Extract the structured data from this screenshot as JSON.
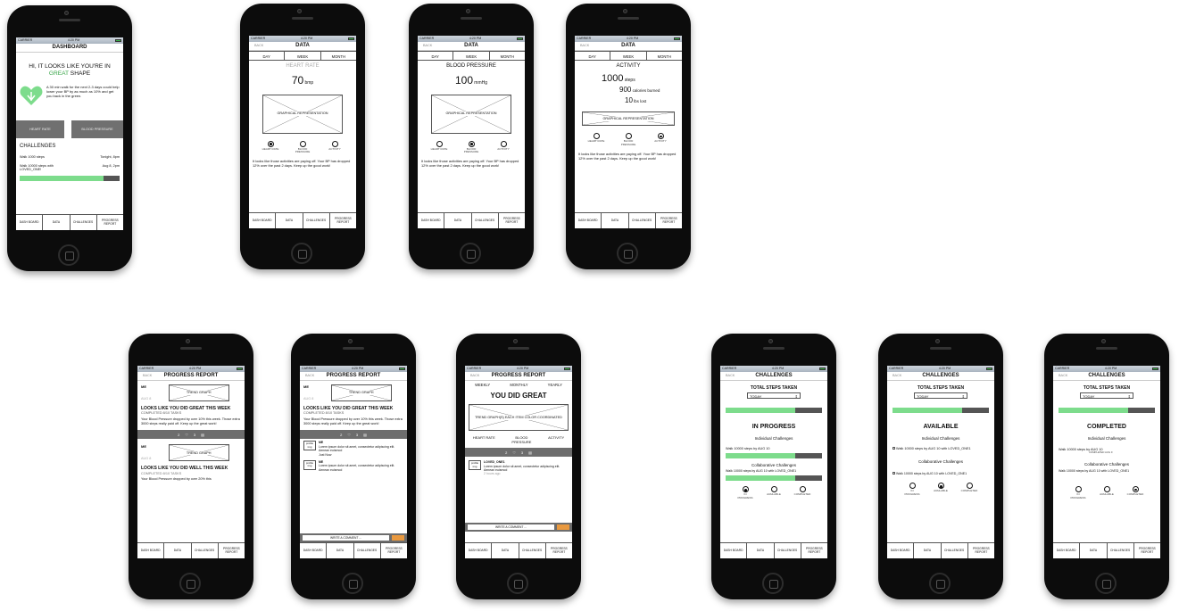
{
  "status": {
    "carrier": "CARRIER",
    "network": "5G",
    "time": "4:20 PM"
  },
  "tabs": {
    "dash": "DASH BOARD",
    "data": "DATA",
    "challenges": "CHALLENGES",
    "progress": "PROGRESS REPORT"
  },
  "back": "BACK",
  "dashboard": {
    "title": "DASHBOARD",
    "headline_a": "HI, IT LOOKS LIKE YOU'RE IN",
    "headline_great": "GREAT",
    "headline_b": "SHAPE",
    "tip": "A 30 min walk for the next 2-3 days could help lower your BP by as much as 10% and get you back in the green.",
    "btn_heart": "HEART RATE",
    "btn_bp": "BLOOD PRESSURE",
    "challenges_title": "CHALLENGES",
    "ch1": "Walk 1000 steps",
    "ch1_time": "Tonight, 8pm",
    "ch2": "Walk 10000 steps with LOVED_ONE!",
    "ch2_time": "Aug 8, 2pm",
    "progress": 0.78
  },
  "data": {
    "title": "DATA",
    "seg": [
      "DAY",
      "WEEK",
      "MONTH"
    ],
    "graphic": "GRAPHICAL REPRESENTATION",
    "radio_labels": [
      "HEART RATE",
      "BLOOD PRESSURE",
      "ACTIVITY"
    ],
    "note": "It looks like those activities are paying off. Your BP has dropped 12% over the past 2 days. Keep up the good work!",
    "hr_title": "HEART RATE",
    "hr_value": "70",
    "hr_unit": "bmp",
    "bp_title": "BLOOD PRESSURE",
    "bp_value": "100",
    "bp_unit": "mmHg",
    "act_title": "ACTIVITY",
    "act_steps": "1000",
    "act_steps_unit": "steps",
    "act_cal": "900",
    "act_cal_unit": "calories burned",
    "act_lbs": "10",
    "act_lbs_unit": "lbs lost"
  },
  "progress": {
    "title": "PROGRESS REPORT",
    "me": "ME",
    "date": "AUG 8",
    "trend": "TREND GRAPH",
    "great_week": "LOOKS LIKE YOU DID GREAT THIS WEEK",
    "well_week": "LOOKS LIKE YOU DID WELL THIS WEEK",
    "completed": "COMPLETED 8/10 TASKS",
    "body": "Your Blood Pressure dropped by over 10% this week. Those extra 3000 steps really paid off. Keep up the great work!",
    "body_cut": "Your Blood Pressure dropped by over 20% this",
    "likes": "2",
    "comments": "3",
    "profile": "profile img",
    "lorem": "Lorem ipsum dolor sit amet, consectetur adipiscing elit. Aenean euismod",
    "just_now": "Just Now",
    "write": "WRITE A COMMENT ...",
    "periods": [
      "WEEKLY",
      "MONTHLY",
      "YEARLY"
    ],
    "did_great": "YOU DID GREAT",
    "trend_each": "TREND GRAPH(S) EACH ITEM COLOR COORDINATED",
    "cats": [
      "HEART RATE",
      "BLOOD PRESSURE",
      "ACTIVITY"
    ],
    "loved": "LOVED_ONE1",
    "ago": "2 hours ago"
  },
  "challenges": {
    "title": "CHALLENGES",
    "total": "TOTAL STEPS TAKEN",
    "today": "TODAY",
    "in_progress": "IN PROGRESS",
    "available": "AVAILABLE",
    "completed": "COMPLETED",
    "individual": "Individual Challenges",
    "collaborative": "Collaborative Challenges",
    "walk_aug": "Walk 10000 steps by AUG 10",
    "walk_loved": "Walk 10000 steps by AUG 10 with LOVED_ONE1",
    "completed_aug": "COMPLETED AUG 9",
    "radio_labels": [
      "IN PROGRESS",
      "AVAILABLE",
      "COMPLETED"
    ],
    "progress": 0.78
  }
}
